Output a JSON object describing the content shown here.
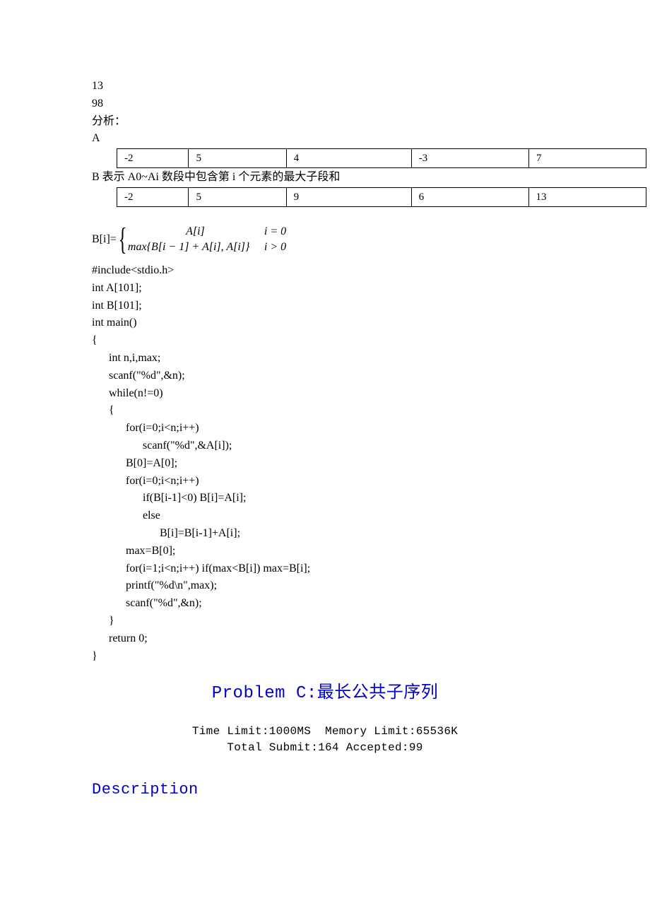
{
  "intro": {
    "line1": "13",
    "line2": "98",
    "line3": "分析：",
    "labelA": "A",
    "labelB": "B  表示 A0~Ai 数段中包含第 i 个元素的最大子段和"
  },
  "tableA": [
    "-2",
    "5",
    "4",
    "-3",
    "7"
  ],
  "tableB": [
    "-2",
    "5",
    "9",
    "6",
    "13"
  ],
  "formula": {
    "lhs": "B[i]=",
    "case1_expr": "A[i]",
    "case1_cond": "i = 0",
    "case2_expr": "max{B[i − 1] + A[i], A[i]}",
    "case2_cond": "i > 0"
  },
  "code": {
    "l01": "#include<stdio.h>",
    "l02": "int A[101];",
    "l03": "int B[101];",
    "l04": "int main()",
    "l05": "{",
    "l06": "      int n,i,max;",
    "l07": "      scanf(\"%d\",&n);",
    "l08": "      while(n!=0)",
    "l09": "      {",
    "l10": "            for(i=0;i<n;i++)",
    "l11": "                  scanf(\"%d\",&A[i]);",
    "l12": "            B[0]=A[0];",
    "l13": "            for(i=0;i<n;i++)",
    "l14": "                  if(B[i-1]<0) B[i]=A[i];",
    "l15": "                  else",
    "l16": "                        B[i]=B[i-1]+A[i];",
    "l17": "            max=B[0];",
    "l18": "            for(i=1;i<n;i++) if(max<B[i]) max=B[i];",
    "l19": "            printf(\"%d\\n\",max);",
    "l20": "            scanf(\"%d\",&n);",
    "l21": "      }",
    "l22": "      return 0;",
    "l23": "}"
  },
  "problem": {
    "title": "Problem C:最长公共子序列",
    "time_limit": "Time Limit:1000MS",
    "memory_limit": "Memory Limit:65536K",
    "total_submit": "Total Submit:164 Accepted:99",
    "section_heading": "Description"
  }
}
